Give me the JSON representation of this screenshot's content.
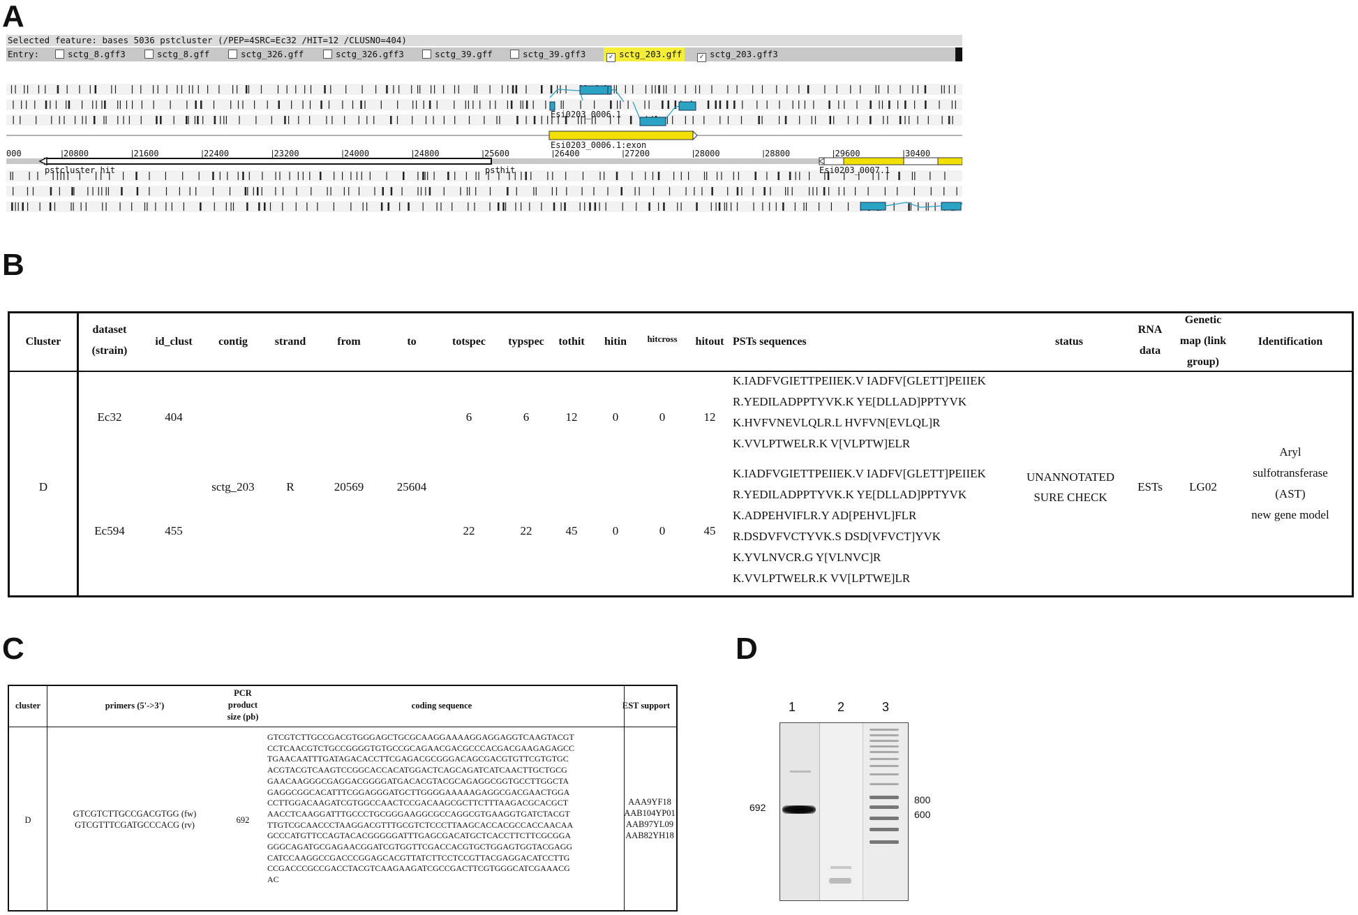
{
  "panels": {
    "a": "A",
    "b": "B",
    "c": "C",
    "d": "D"
  },
  "panel_a": {
    "selected_feature": "Selected feature:  bases 5036  pstcluster  (/PEP=4SRC=Ec32 /HIT=12 /CLUSNO=404)",
    "entry_label": "Entry:",
    "entries": [
      {
        "label": "sctg_8.gff3",
        "checked": false,
        "highlight": false
      },
      {
        "label": "sctg_8.gff",
        "checked": false,
        "highlight": false
      },
      {
        "label": "sctg_326.gff",
        "checked": false,
        "highlight": false
      },
      {
        "label": "sctg_326.gff3",
        "checked": false,
        "highlight": false
      },
      {
        "label": "sctg_39.gff",
        "checked": false,
        "highlight": false
      },
      {
        "label": "sctg_39.gff3",
        "checked": false,
        "highlight": false
      },
      {
        "label": "sctg_203.gff",
        "checked": true,
        "highlight": true
      },
      {
        "label": "sctg_203.gff3",
        "checked": true,
        "highlight": false
      }
    ],
    "feature_labels": {
      "gene1": "Esi0203_0006.1",
      "exon": "Esi0203_0006.1:exon",
      "pstcluster": "pstcluster hit",
      "psthit": "psthit",
      "gene2": "Esi0203_0007.1"
    },
    "ruler_ticks": [
      "000",
      "20800",
      "21600",
      "22400",
      "23200",
      "24000",
      "24800",
      "25600",
      "26400",
      "27200",
      "28000",
      "28800",
      "29600",
      "30400"
    ],
    "colors": {
      "gene": "#2ba3c4",
      "exon": "#f1e000",
      "highlight": "#f4ee3a"
    }
  },
  "panel_b": {
    "headers": {
      "cluster": "Cluster",
      "dataset_1": "dataset",
      "dataset_2": "(strain)",
      "id_clust": "id_clust",
      "contig": "contig",
      "strand": "strand",
      "from": "from",
      "to": "to",
      "totspec": "totspec",
      "typspec": "typspec",
      "tothit": "tothit",
      "hitin": "hitin",
      "hitcross": "hitcross",
      "hitout": "hitout",
      "psts": "PSTs  sequences",
      "status": "status",
      "rna_1": "RNA",
      "rna_2": "data",
      "genetic_1": "Genetic",
      "genetic_2": "map (link",
      "genetic_3": "group)",
      "identification": "Identification"
    },
    "shared": {
      "cluster": "D",
      "contig": "sctg_203",
      "strand": "R",
      "from": "20569",
      "to": "25604",
      "status_1": "UNANNOTATED",
      "status_2": "SURE CHECK",
      "rna": "ESTs",
      "genetic_map": "LG02",
      "ident_1": "Aryl",
      "ident_2": "sulfotransferase",
      "ident_3": "(AST)",
      "ident_4": "new gene model"
    },
    "rows": [
      {
        "dataset": "Ec32",
        "id_clust": "404",
        "totspec": "6",
        "typspec": "6",
        "tothit": "12",
        "hitin": "0",
        "hitcross": "0",
        "hitout": "12",
        "psts": [
          "K.IADFVGIETTPEIIEK.V  IADFV[GLETT]PEIIEK",
          "R.YEDILADPPTYVK.K  YE[DLLAD]PPTYVK",
          "K.HVFVNEVLQLR.L  HVFVN[EVLQL]R",
          "K.VVLPTWELR.K  V[VLPTW]ELR"
        ]
      },
      {
        "dataset": "Ec594",
        "id_clust": "455",
        "totspec": "22",
        "typspec": "22",
        "tothit": "45",
        "hitin": "0",
        "hitcross": "0",
        "hitout": "45",
        "psts": [
          "K.IADFVGIETTPEIIEK.V  IADFV[GLETT]PEIIEK",
          "R.YEDILADPPTYVK.K  YE[DLLAD]PPTYVK",
          "K.ADPEHVIFLR.Y  AD[PEHVL]FLR",
          "R.DSDVFVCTYVK.S  DSD[VFVCT]YVK",
          "K.YVLNVCR.G  Y[VLNVC]R",
          "K.VVLPTWELR.K  VV[LPTWE]LR"
        ]
      }
    ]
  },
  "panel_c": {
    "headers": {
      "cluster": "cluster",
      "primers": "primers (5'->3')",
      "pcr_1": "PCR",
      "pcr_2": "product",
      "pcr_3": "size (pb)",
      "coding": "coding sequence",
      "est": "EST support"
    },
    "row": {
      "cluster": "D",
      "primer_fw": "GTCGTCTTGCCGACGTGG (fw)",
      "primer_rv": "GTCGTTTCGATGCCCACG (rv)",
      "pcr_size": "692",
      "sequence": [
        "GTCGTCTTGCCGACGTGGGAGCTGCGCAAGGAAAAGGAGGAGGTCAAGTACGT",
        "CCTCAACGTCTGCCGGGGTGTGCCGCAGAACGACGCCCACGACGAAGAGAGCC",
        "TGAACAATTTGATAGACACCTTCGAGACGCGGGACAGCGACGTGTTCGTGTGC",
        "ACGTACGTCAAGTCCGGCACCACATGGACTCAGCAGATCATCAACTTGCTGCG",
        "GAACAAGGGCGAGGACGGGGATGACACGTACGCAGAGGCGGTGCCTTGGCTA",
        "GAGGCGGCACATTTCGGAGGGATGCTTGGGGAAAAAGAGGCGACGAACTGGA",
        "CCTTGGACAAGATCGTGGCCAACTCCGACAAGCGCTTCTTTAAGACGCACGCT",
        "AACCTCAAGGATTTGCCCTGCGGGAAGGCGCCAGGCGTGAAGGTGATCTACGT",
        "TTGTCGCAACCCTAAGGACGTTTGCGTCTCCCTTAAGCACCACGCCACCAACAA",
        "GCCCATGTTCCAGTACACGGGGGATTTGAGCGACATGCTCACCTTCTTCGCGGA",
        "GGGCAGATGCGAGAACGGATCGTGGTTCGACCACGTGCTGGAGTGGTACGAGG",
        "CATCCAAGGCCGACCCGGAGCACGTTATCTTCCTCCGTTACGAGGACATCCTTG",
        "CCGACCCGCCGACCTACGTCAAGAAGATCGCCGACTTCGTGGGCATCGAAACG",
        "AC"
      ],
      "est": [
        "AAA9YF18",
        "AAB104YP01",
        "AAB97YL09",
        "AAB82YH18"
      ]
    }
  },
  "panel_d": {
    "lanes": [
      "1",
      "2",
      "3"
    ],
    "band_label": "692",
    "ladder_labels": [
      "800",
      "600"
    ]
  }
}
